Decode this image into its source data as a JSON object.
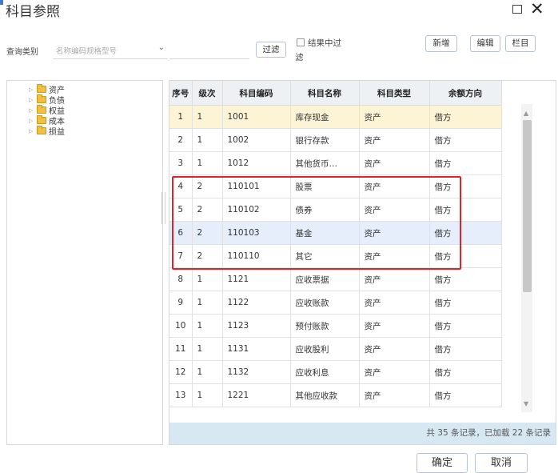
{
  "window": {
    "title": "科目参照"
  },
  "query": {
    "label": "查询类别",
    "placeholder": "名称编码规格型号",
    "filter_label": "过滤",
    "filter_result_line1": "结果中过",
    "filter_result_line2": "滤"
  },
  "toolbar": {
    "add": "新增",
    "edit": "编辑",
    "columns": "栏目"
  },
  "tree": {
    "items": [
      "资产",
      "负债",
      "权益",
      "成本",
      "损益"
    ]
  },
  "grid": {
    "headers": [
      "序号",
      "级次",
      "科目编码",
      "科目名称",
      "科目类型",
      "余额方向"
    ],
    "rows": [
      [
        "1",
        "1",
        "1001",
        "库存现金",
        "资产",
        "借方"
      ],
      [
        "2",
        "1",
        "1002",
        "银行存款",
        "资产",
        "借方"
      ],
      [
        "3",
        "1",
        "1012",
        "其他货币…",
        "资产",
        "借方"
      ],
      [
        "4",
        "2",
        "110101",
        "股票",
        "资产",
        "借方"
      ],
      [
        "5",
        "2",
        "110102",
        "债券",
        "资产",
        "借方"
      ],
      [
        "6",
        "2",
        "110103",
        "基金",
        "资产",
        "借方"
      ],
      [
        "7",
        "2",
        "110110",
        "其它",
        "资产",
        "借方"
      ],
      [
        "8",
        "1",
        "1121",
        "应收票据",
        "资产",
        "借方"
      ],
      [
        "9",
        "1",
        "1122",
        "应收账款",
        "资产",
        "借方"
      ],
      [
        "10",
        "1",
        "1123",
        "预付账款",
        "资产",
        "借方"
      ],
      [
        "11",
        "1",
        "1131",
        "应收股利",
        "资产",
        "借方"
      ],
      [
        "12",
        "1",
        "1132",
        "应收利息",
        "资产",
        "借方"
      ],
      [
        "13",
        "1",
        "1221",
        "其他应收款",
        "资产",
        "借方"
      ]
    ],
    "selected_row": 1,
    "hover_row": 6,
    "footer": "共 35 条记录，已加载 22 条记录"
  },
  "dialog": {
    "ok": "确定",
    "cancel": "取消"
  },
  "colors": {
    "highlight": "#e0242b",
    "selected_row": "#fcf4d4",
    "hover_row": "#e5eefa",
    "footer": "#d8e8f3"
  }
}
